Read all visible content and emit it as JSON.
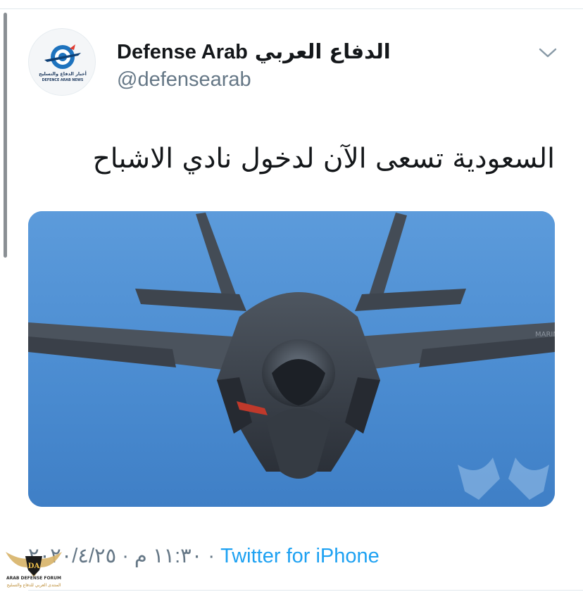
{
  "tweet": {
    "author_name_en": "Defense Arab",
    "author_name_ar": "الدفاع العربي",
    "handle": "@defensearab",
    "text": "السعودية تسعى الآن لدخول نادي الاشباح",
    "timestamp": "١١:٣٠ م · ٢٠٢٠/٤/٢٥ · ",
    "source": "Twitter for iPhone"
  },
  "avatar": {
    "logo_text_ar": "أخبار الدفاع والتسليح",
    "logo_text_en": "DEFENCE ARAB NEWS"
  },
  "media": {
    "aircraft_marking": "MARINES"
  },
  "watermark": {
    "title": "ARAB DEFENSE FORUM",
    "subtitle": "المنتدى العربي للدفاع والتسليح",
    "badge_text": "DA"
  },
  "icons": {
    "more": "chevron-down-icon"
  },
  "colors": {
    "link": "#1da1f2",
    "secondary_text": "#657786",
    "primary_text": "#14171a",
    "sky": "#4f90d3"
  }
}
